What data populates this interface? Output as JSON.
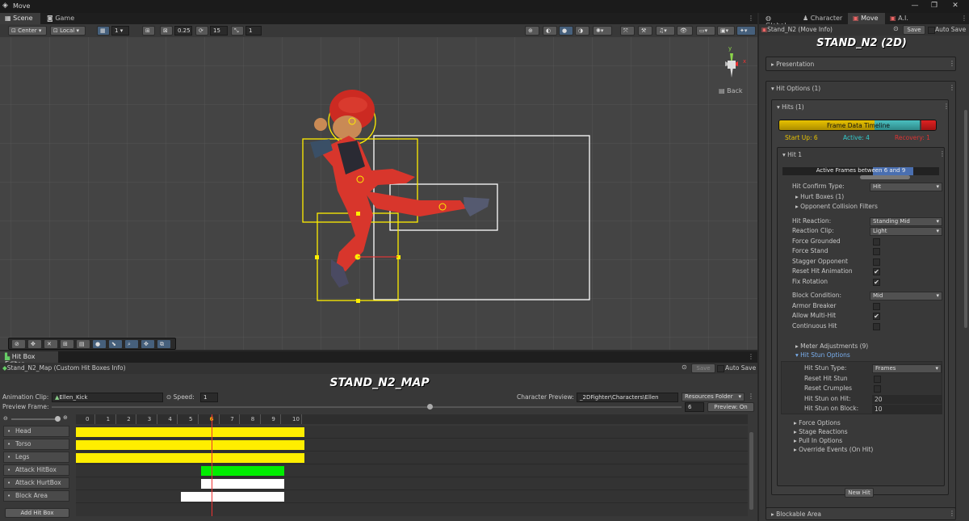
{
  "window": {
    "title": "Move",
    "controls": [
      "—",
      "❐",
      "✕"
    ]
  },
  "scene_tabs": [
    "Scene",
    "Game"
  ],
  "scene_toolbar": {
    "pivot": "Center",
    "space": "Local",
    "grid_value": "1",
    "snap_a": "0.25",
    "snap_b": "15",
    "snap_c": "1"
  },
  "gizmo": {
    "axis_y": "y",
    "axis_x": "x",
    "view": "Back"
  },
  "inspector_tabs": [
    "Global",
    "Character",
    "Move",
    "A.I."
  ],
  "inspector": {
    "path": "Stand_N2 (Move Info)",
    "save": "Save",
    "auto_save": "Auto Save",
    "title": "STAND_N2 (2D)",
    "presentation": "Presentation",
    "hit_options": "Hit Options (1)",
    "hits": "Hits (1)",
    "timeline_label": "Frame Data Timeline",
    "startup": "Start Up: 6",
    "active": "Active: 4",
    "recovery": "Recovery: 1",
    "hit1": "Hit 1",
    "active_frames": "Active Frames between 6 and 9",
    "fields": [
      {
        "label": "Hit Confirm Type:",
        "type": "dropdown",
        "value": "Hit"
      },
      {
        "label": "Hurt Boxes (1)",
        "type": "foldout"
      },
      {
        "label": "Opponent Collision Filters",
        "type": "foldout"
      },
      {
        "label": "Hit Reaction:",
        "type": "dropdown",
        "value": "Standing Mid"
      },
      {
        "label": "Reaction Clip:",
        "type": "dropdown",
        "value": "Light"
      },
      {
        "label": "Force Grounded",
        "type": "check",
        "value": ""
      },
      {
        "label": "Force Stand",
        "type": "check",
        "value": ""
      },
      {
        "label": "Stagger Opponent",
        "type": "check",
        "value": ""
      },
      {
        "label": "Reset Hit Animation",
        "type": "check",
        "value": "✔"
      },
      {
        "label": "Fix Rotation",
        "type": "check",
        "value": "✔"
      },
      {
        "label": "Block Condition:",
        "type": "dropdown",
        "value": "Mid"
      },
      {
        "label": "Armor Breaker",
        "type": "check",
        "value": ""
      },
      {
        "label": "Allow Multi-Hit",
        "type": "check",
        "value": "✔"
      },
      {
        "label": "Continuous Hit",
        "type": "check",
        "value": ""
      }
    ],
    "meter": "Meter Adjustments (9)",
    "hitstun": "Hit Stun Options",
    "hitstun_fields": [
      {
        "label": "Hit Stun Type:",
        "type": "dropdown",
        "value": "Frames"
      },
      {
        "label": "Reset Hit Stun",
        "type": "check",
        "value": ""
      },
      {
        "label": "Reset Crumples",
        "type": "check",
        "value": ""
      },
      {
        "label": "Hit Stun on Hit:",
        "type": "text",
        "value": "20"
      },
      {
        "label": "Hit Stun on Block:",
        "type": "text",
        "value": "10"
      }
    ],
    "foldouts": [
      "Force Options",
      "Stage Reactions",
      "Pull In Options",
      "Override Events (On Hit)"
    ],
    "new_hit": "New Hit",
    "blockable": "Blockable Area"
  },
  "hitbox_editor": {
    "tab": "Hit Box Editor",
    "path": "Stand_N2_Map (Custom Hit Boxes Info)",
    "save": "Save",
    "auto_save": "Auto Save",
    "title": "STAND_N2_MAP",
    "clip_label": "Animation Clip:",
    "clip": "Ellen_Kick",
    "speed_label": "Speed:",
    "speed": "1",
    "char_label": "Character Preview:",
    "char_path": "_2DFighter\\Characters\\Ellen",
    "resources": "Resources Folder",
    "preview_frame": "Preview Frame:",
    "frame_value": "6",
    "preview_btn": "Preview: On",
    "frames": [
      "0",
      "1",
      "2",
      "3",
      "4",
      "5",
      "6",
      "7",
      "8",
      "9",
      "10"
    ],
    "tracks": [
      "Head",
      "Torso",
      "Legs",
      "Attack HitBox",
      "Attack HurtBox",
      "Block Area"
    ],
    "add": "Add Hit Box",
    "colors": {
      "hitbox": "#ffee00",
      "attack": "#00ee00",
      "hurt": "#ffffff"
    }
  }
}
